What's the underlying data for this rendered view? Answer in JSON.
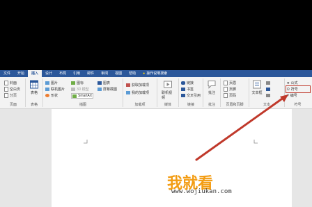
{
  "tabs": [
    "文件",
    "开始",
    "插入",
    "设计",
    "布局",
    "引用",
    "邮件",
    "审阅",
    "视图",
    "帮助"
  ],
  "tell_me": "操作说明搜索",
  "colors": {
    "ribbon_blue": "#2b579a",
    "highlight_red": "#c0392b",
    "arrow_red": "#c0392b",
    "watermark_orange": "#f39c12"
  },
  "groups": {
    "pages": {
      "label": "页面",
      "items": [
        "封面",
        "空白页",
        "分页"
      ]
    },
    "tables": {
      "label": "表格",
      "button": "表格"
    },
    "illustrations": {
      "label": "插图",
      "items": [
        "图片",
        "联机图片",
        "形状",
        "图标",
        "3D 模型",
        "SmartArt",
        "图表",
        "屏幕截图"
      ]
    },
    "addins": {
      "label": "加载项",
      "items": [
        "获取加载项",
        "我的加载项"
      ]
    },
    "media": {
      "label": "媒体",
      "button": "联机视频"
    },
    "links": {
      "label": "链接",
      "items": [
        "链接",
        "书签",
        "交叉引用"
      ]
    },
    "comments": {
      "label": "批注",
      "button": "批注"
    },
    "header_footer": {
      "label": "页眉和页脚",
      "items": [
        "页眉",
        "页脚",
        "页码"
      ]
    },
    "text": {
      "label": "文本",
      "button": "文本框"
    },
    "symbols": {
      "label": "符号",
      "items": [
        "公式",
        "符号",
        "编号"
      ]
    }
  },
  "watermark": {
    "text": "我就看",
    "url": "www.wojiukan.com"
  }
}
